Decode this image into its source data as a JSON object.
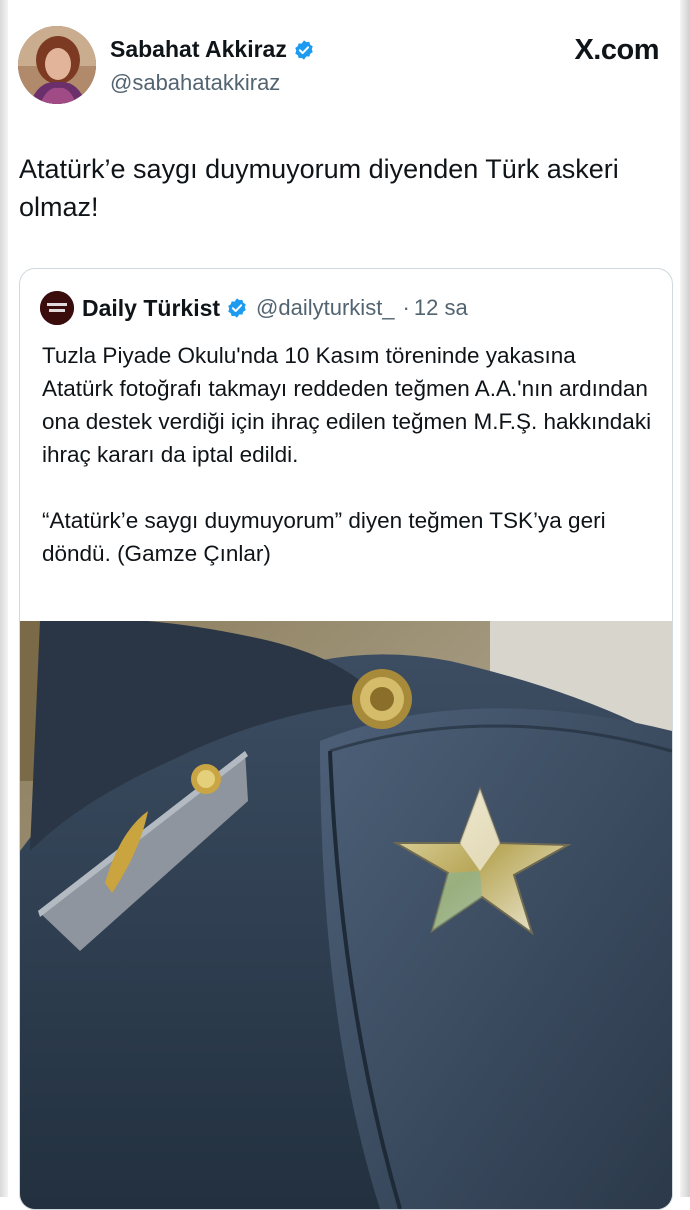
{
  "header": {
    "display_name": "Sabahat Akkiraz",
    "handle": "@sabahatakkiraz",
    "brand": "X.com",
    "verified_icon": "verified-badge-icon",
    "accent": "#1d9bf0"
  },
  "tweet": {
    "text": "Atatürk’e saygı duymuyorum diyenden Türk askeri olmaz!"
  },
  "quote": {
    "logo_text": "Daily Türkist",
    "display_name": "Daily Türkist",
    "handle": "@dailyturkist_",
    "separator": "·",
    "time": "12 sa",
    "text": "Tuzla Piyade Okulu'nda 10 Kasım töreninde yakasına Atatürk fotoğrafı takmayı reddeden teğmen A.A.'nın ardından ona destek verdiği için ihraç edilen teğmen M.F.Ş. hakkındaki ihraç kararı da iptal edildi.\n\n“Atatürk’e saygı duymuyorum” diyen teğmen TSK’ya geri döndü. (Gamze Çınlar)",
    "image": "military-uniform-shoulder-with-star-photo"
  }
}
